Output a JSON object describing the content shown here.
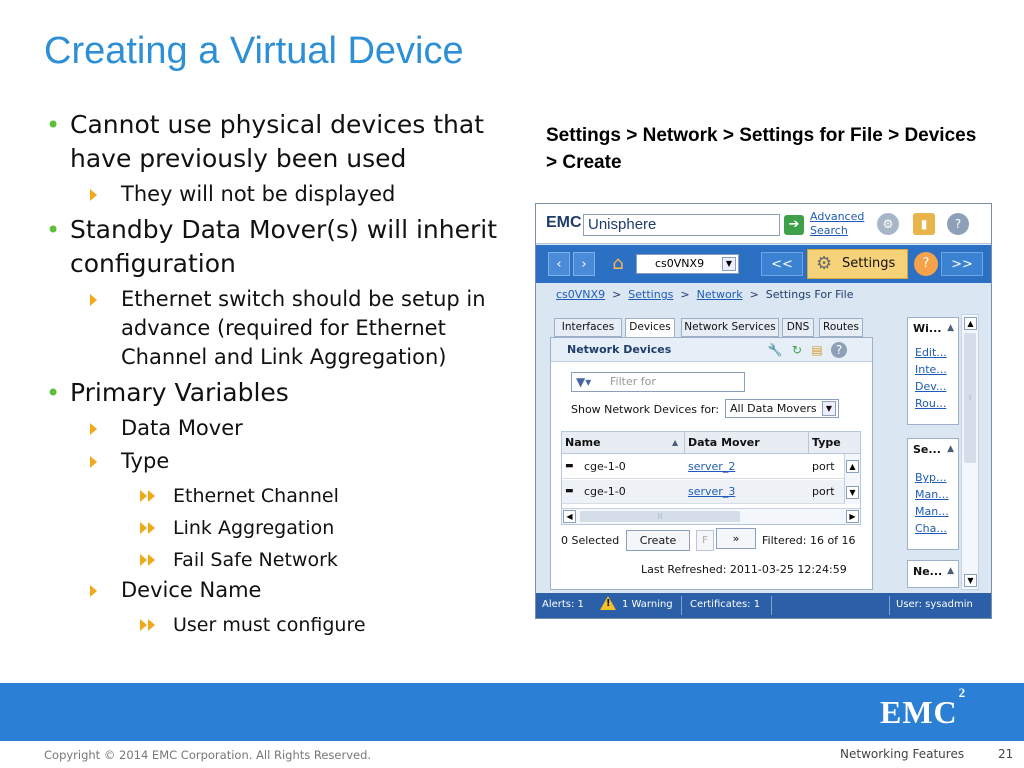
{
  "slide": {
    "title": "Creating a Virtual Device",
    "bullets": {
      "b1": "Cannot use physical devices that have previously been used",
      "b1_1": "They will not be displayed",
      "b2": "Standby Data Mover(s) will inherit configuration",
      "b2_1": "Ethernet switch should be setup in advance (required for Ethernet Channel and Link Aggregation)",
      "b3": "Primary Variables",
      "b3_1": "Data Mover",
      "b3_2": "Type",
      "b3_2_1": "Ethernet Channel",
      "b3_2_2": "Link Aggregation",
      "b3_2_3": "Fail Safe Network",
      "b3_3": "Device Name",
      "b3_3_1": "User must configure"
    },
    "path_caption": "Settings > Network > Settings for File > Devices > Create",
    "footer": {
      "logo": "EMC",
      "logo_sup": "2",
      "copyright": "Copyright © 2014 EMC Corporation. All Rights Reserved.",
      "section": "Networking Features",
      "page": "21"
    },
    "colors": {
      "title": "#2d8fd5",
      "bullet_dot": "#5bbf3a",
      "arrow": "#f0a81c",
      "footer_bar": "#2b7fd4"
    }
  },
  "unisphere": {
    "logo": "EMC",
    "app_name": "Unisphere",
    "advanced_search": [
      "Advanced",
      "Search"
    ],
    "nav": {
      "system_select": "cs0VNX9",
      "prev": "<<",
      "settings": "Settings",
      "next": ">>"
    },
    "breadcrumb": [
      "cs0VNX9",
      "Settings",
      "Network",
      "Settings For File"
    ],
    "tabs": [
      "Interfaces",
      "Devices",
      "Network Services",
      "DNS",
      "Routes"
    ],
    "panel": {
      "title": "Network Devices",
      "filter_placeholder": "Filter for",
      "show_label": "Show Network Devices for:",
      "show_value": "All Data Movers",
      "columns": [
        "Name",
        "Data Mover",
        "Type"
      ],
      "rows": [
        {
          "name": "cge-1-0",
          "mover": "server_2",
          "type": "port"
        },
        {
          "name": "cge-1-0",
          "mover": "server_3",
          "type": "port"
        }
      ],
      "selected": "0 Selected",
      "create": "Create",
      "f_btn": "F",
      "more": "»",
      "filtered": "Filtered: 16 of 16",
      "refreshed": "Last Refreshed: 2011-03-25 12:24:59"
    },
    "side": {
      "box1_title": "Wi...",
      "box1_links": [
        "Edit...",
        "Inte...",
        "Dev...",
        "Rou..."
      ],
      "box2_title": "Se...",
      "box2_links": [
        "Byp...",
        "Man...",
        "Man...",
        "Cha..."
      ],
      "box3_title": "Ne..."
    },
    "status": {
      "alerts": "Alerts:  1",
      "warning": "1  Warning",
      "certificates": "Certificates:  1",
      "user": "User: sysadmin"
    }
  }
}
